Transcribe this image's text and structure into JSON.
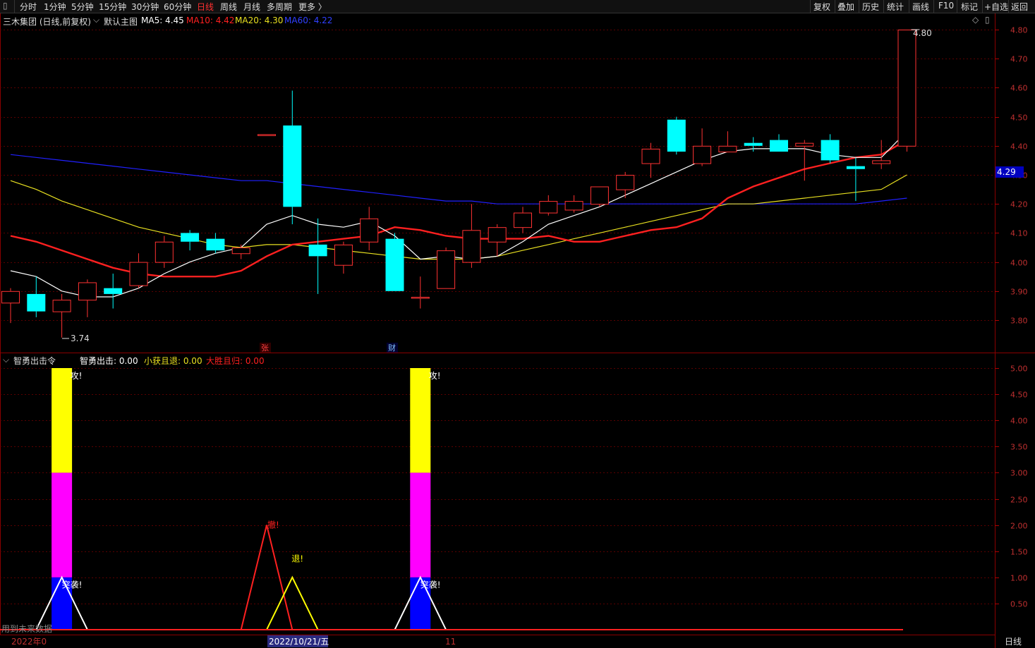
{
  "toolbar": {
    "periods": [
      "分时",
      "1分钟",
      "5分钟",
      "15分钟",
      "30分钟",
      "60分钟",
      "日线",
      "周线",
      "月线",
      "多周期",
      "更多 〉"
    ],
    "active_period": "日线",
    "right_items": [
      "复权",
      "叠加",
      "历史",
      "统计",
      "画线",
      "F10",
      "标记",
      "+自选",
      "返回"
    ]
  },
  "main": {
    "title": "三木集团 (日线,前复权)",
    "chart_name": "默认主图",
    "ma5_label": "MA5: 4.45",
    "ma10_label": "MA10: 4.42",
    "ma20_label": "MA20: 4.30",
    "ma60_label": "MA60: 4.22",
    "high_label": "4.80",
    "low_label": "3.74",
    "current_price": "4.29",
    "marker_zhang": "张",
    "marker_cai": "财"
  },
  "sub": {
    "name": "智勇出击令",
    "label1": "智勇出击: 0.00",
    "label2": "小获且退: 0.00",
    "label3": "大胜且归: 0.00",
    "text_attack": "攻!",
    "text_raid": "突袭!",
    "text_withdraw": "撤!",
    "text_retreat": "退!",
    "footer_note": "用到未来数据"
  },
  "xaxis": {
    "year_label": "2022年0",
    "date_cursor": "2022/10/21/五",
    "month_label": "11",
    "period_label": "日线"
  },
  "colors": {
    "up": "#ff3232",
    "down": "#00ffff",
    "ma5": "#ffffff",
    "ma10": "#ff2020",
    "ma20": "#e8e020",
    "ma60": "#2020ff",
    "axis": "#b00000",
    "bar_yellow": "#ffff00",
    "bar_magenta": "#ff00ff",
    "bar_blue": "#0000ff"
  },
  "chart_data": [
    {
      "type": "candlestick",
      "title": "三木集团 (日线,前复权)",
      "y_ticks": [
        3.8,
        3.9,
        4.0,
        4.1,
        4.2,
        4.3,
        4.4,
        4.5,
        4.6,
        4.7,
        4.8
      ],
      "ylim": [
        3.7,
        4.83
      ],
      "candles": [
        {
          "o": 3.86,
          "h": 3.91,
          "l": 3.79,
          "c": 3.9
        },
        {
          "o": 3.89,
          "h": 3.95,
          "l": 3.81,
          "c": 3.83
        },
        {
          "o": 3.83,
          "h": 3.89,
          "l": 3.74,
          "c": 3.87
        },
        {
          "o": 3.87,
          "h": 3.94,
          "l": 3.81,
          "c": 3.93
        },
        {
          "o": 3.91,
          "h": 3.96,
          "l": 3.84,
          "c": 3.89
        },
        {
          "o": 3.92,
          "h": 4.03,
          "l": 3.91,
          "c": 4.0
        },
        {
          "o": 4.0,
          "h": 4.09,
          "l": 3.98,
          "c": 4.07
        },
        {
          "o": 4.1,
          "h": 4.11,
          "l": 4.04,
          "c": 4.07
        },
        {
          "o": 4.08,
          "h": 4.1,
          "l": 4.03,
          "c": 4.04
        },
        {
          "o": 4.03,
          "h": 4.06,
          "l": 4.01,
          "c": 4.05
        },
        {
          "o": 4.44,
          "h": 4.44,
          "l": 4.44,
          "c": 4.44
        },
        {
          "o": 4.47,
          "h": 4.59,
          "l": 4.13,
          "c": 4.19
        },
        {
          "o": 4.06,
          "h": 4.15,
          "l": 3.89,
          "c": 4.02
        },
        {
          "o": 3.99,
          "h": 4.07,
          "l": 3.96,
          "c": 4.06
        },
        {
          "o": 4.07,
          "h": 4.19,
          "l": 4.04,
          "c": 4.15
        },
        {
          "o": 4.08,
          "h": 4.1,
          "l": 3.9,
          "c": 3.9
        },
        {
          "o": 3.88,
          "h": 3.95,
          "l": 3.84,
          "c": 3.88
        },
        {
          "o": 3.91,
          "h": 4.05,
          "l": 3.91,
          "c": 4.04
        },
        {
          "o": 4.0,
          "h": 4.2,
          "l": 3.98,
          "c": 4.11
        },
        {
          "o": 4.07,
          "h": 4.13,
          "l": 4.02,
          "c": 4.12
        },
        {
          "o": 4.12,
          "h": 4.19,
          "l": 4.1,
          "c": 4.17
        },
        {
          "o": 4.17,
          "h": 4.23,
          "l": 4.16,
          "c": 4.21
        },
        {
          "o": 4.18,
          "h": 4.23,
          "l": 4.17,
          "c": 4.21
        },
        {
          "o": 4.2,
          "h": 4.25,
          "l": 4.19,
          "c": 4.26
        },
        {
          "o": 4.25,
          "h": 4.31,
          "l": 4.22,
          "c": 4.3
        },
        {
          "o": 4.34,
          "h": 4.41,
          "l": 4.29,
          "c": 4.39
        },
        {
          "o": 4.49,
          "h": 4.5,
          "l": 4.37,
          "c": 4.38
        },
        {
          "o": 4.34,
          "h": 4.46,
          "l": 4.33,
          "c": 4.4
        },
        {
          "o": 4.38,
          "h": 4.45,
          "l": 4.38,
          "c": 4.4
        },
        {
          "o": 4.41,
          "h": 4.43,
          "l": 4.38,
          "c": 4.4
        },
        {
          "o": 4.42,
          "h": 4.44,
          "l": 4.38,
          "c": 4.38
        },
        {
          "o": 4.4,
          "h": 4.42,
          "l": 4.28,
          "c": 4.41
        },
        {
          "o": 4.42,
          "h": 4.44,
          "l": 4.34,
          "c": 4.35
        },
        {
          "o": 4.33,
          "h": 4.36,
          "l": 4.21,
          "c": 4.32
        },
        {
          "o": 4.34,
          "h": 4.42,
          "l": 4.32,
          "c": 4.35
        },
        {
          "o": 4.4,
          "h": 4.8,
          "l": 4.38,
          "c": 4.8
        }
      ],
      "ma5": [
        3.97,
        3.95,
        3.9,
        3.88,
        3.88,
        3.91,
        3.96,
        4.0,
        4.03,
        4.05,
        4.13,
        4.16,
        4.13,
        4.12,
        4.14,
        4.09,
        4.01,
        4.02,
        4.01,
        4.02,
        4.07,
        4.13,
        4.16,
        4.19,
        4.23,
        4.27,
        4.31,
        4.35,
        4.38,
        4.39,
        4.39,
        4.39,
        4.37,
        4.36,
        4.36,
        4.45
      ],
      "ma10": [
        4.09,
        4.07,
        4.04,
        4.01,
        3.98,
        3.96,
        3.95,
        3.95,
        3.95,
        3.97,
        4.02,
        4.06,
        4.07,
        4.08,
        4.09,
        4.12,
        4.11,
        4.09,
        4.08,
        4.08,
        4.08,
        4.09,
        4.07,
        4.07,
        4.09,
        4.11,
        4.12,
        4.15,
        4.22,
        4.26,
        4.29,
        4.32,
        4.34,
        4.36,
        4.37,
        4.42
      ],
      "ma20": [
        4.28,
        4.25,
        4.21,
        4.18,
        4.15,
        4.12,
        4.1,
        4.08,
        4.06,
        4.05,
        4.06,
        4.06,
        4.05,
        4.04,
        4.03,
        4.02,
        4.01,
        4.01,
        4.01,
        4.02,
        4.04,
        4.06,
        4.08,
        4.1,
        4.12,
        4.14,
        4.16,
        4.18,
        4.2,
        4.2,
        4.21,
        4.22,
        4.23,
        4.24,
        4.25,
        4.3
      ],
      "ma60": [
        4.37,
        4.36,
        4.35,
        4.34,
        4.33,
        4.32,
        4.31,
        4.3,
        4.29,
        4.28,
        4.28,
        4.27,
        4.26,
        4.25,
        4.24,
        4.23,
        4.22,
        4.21,
        4.21,
        4.2,
        4.2,
        4.2,
        4.2,
        4.2,
        4.2,
        4.2,
        4.2,
        4.2,
        4.2,
        4.2,
        4.2,
        4.2,
        4.2,
        4.2,
        4.21,
        4.22
      ]
    },
    {
      "type": "bar",
      "title": "智勇出击令",
      "y_ticks": [
        0.5,
        1.0,
        1.5,
        2.0,
        2.5,
        3.0,
        3.5,
        4.0,
        4.5,
        5.0
      ],
      "ylim": [
        0,
        5.0
      ],
      "stacked_bars": [
        {
          "index": 2,
          "segments": [
            {
              "from": 0,
              "to": 1,
              "color": "blue"
            },
            {
              "from": 1,
              "to": 3,
              "color": "magenta"
            },
            {
              "from": 3,
              "to": 5,
              "color": "yellow"
            }
          ]
        },
        {
          "index": 16,
          "segments": [
            {
              "from": 0,
              "to": 1,
              "color": "blue"
            },
            {
              "from": 1,
              "to": 3,
              "color": "magenta"
            },
            {
              "from": 3,
              "to": 5,
              "color": "yellow"
            }
          ]
        }
      ],
      "triangles": [
        {
          "center": 2,
          "height": 1,
          "color": "white"
        },
        {
          "center": 16,
          "height": 1,
          "color": "white"
        },
        {
          "center": 10,
          "height": 2,
          "color": "red"
        },
        {
          "center": 11,
          "height": 1,
          "color": "yellow"
        }
      ]
    }
  ]
}
